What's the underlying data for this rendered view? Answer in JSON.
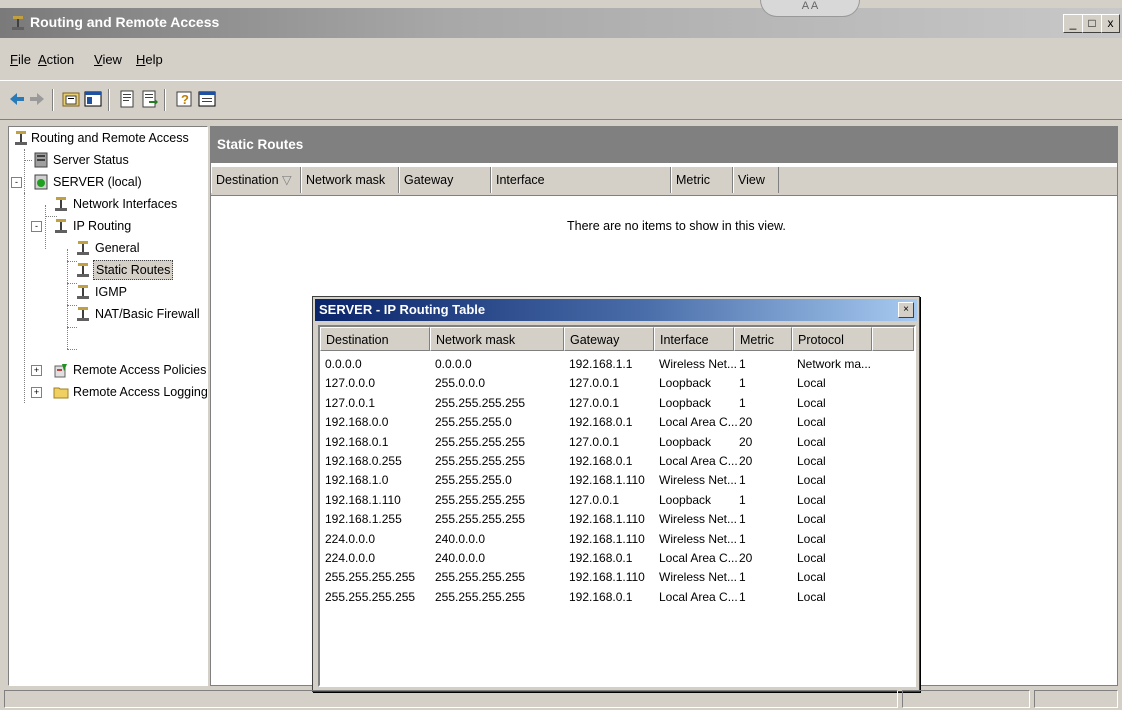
{
  "window": {
    "title": "Routing and Remote Access",
    "notch_text": "A A",
    "controls": {
      "minimize": "_",
      "maximize": "□",
      "close": "x"
    }
  },
  "menu": [
    "File",
    "Action",
    "View",
    "Help"
  ],
  "menu_underline": [
    "F",
    "A",
    "V",
    "H"
  ],
  "toolbar": {
    "icons": [
      "back-arrow-icon",
      "forward-arrow-icon",
      "up-folder-icon",
      "show-hide-tree-icon",
      "properties-icon",
      "export-list-icon",
      "help-icon",
      "console-icon"
    ]
  },
  "tree": {
    "items": [
      {
        "label": "Routing and Remote Access",
        "icon": "server-icon"
      },
      {
        "label": "Server Status",
        "icon": "server-status-icon"
      },
      {
        "label": "SERVER (local)",
        "icon": "server-local-icon"
      },
      {
        "label": "Network Interfaces",
        "icon": "routing-node-icon"
      },
      {
        "label": "IP Routing",
        "icon": "routing-node-icon"
      },
      {
        "label": "General",
        "icon": "routing-node-icon"
      },
      {
        "label": "Static Routes",
        "icon": "routing-node-icon"
      },
      {
        "label": "IGMP",
        "icon": "routing-node-icon"
      },
      {
        "label": "NAT/Basic Firewall",
        "icon": "routing-node-icon"
      },
      {
        "label": "Remote Access Policies",
        "icon": "policy-icon"
      },
      {
        "label": "Remote Access Logging",
        "icon": "folder-icon"
      }
    ]
  },
  "pane": {
    "title": "Static Routes",
    "columns": [
      "Destination",
      "Network mask",
      "Gateway",
      "Interface",
      "Metric",
      "View"
    ],
    "sort_indicator": "▽",
    "empty_message": "There are no items to show in this view."
  },
  "dialog": {
    "title": "SERVER - IP Routing Table",
    "close": "×",
    "columns": [
      "Destination",
      "Network mask",
      "Gateway",
      "Interface",
      "Metric",
      "Protocol"
    ],
    "rows": [
      [
        "0.0.0.0",
        "0.0.0.0",
        "192.168.1.1",
        "Wireless Net...",
        "1",
        "Network ma..."
      ],
      [
        "127.0.0.0",
        "255.0.0.0",
        "127.0.0.1",
        "Loopback",
        "1",
        "Local"
      ],
      [
        "127.0.0.1",
        "255.255.255.255",
        "127.0.0.1",
        "Loopback",
        "1",
        "Local"
      ],
      [
        "192.168.0.0",
        "255.255.255.0",
        "192.168.0.1",
        "Local Area C...",
        "20",
        "Local"
      ],
      [
        "192.168.0.1",
        "255.255.255.255",
        "127.0.0.1",
        "Loopback",
        "20",
        "Local"
      ],
      [
        "192.168.0.255",
        "255.255.255.255",
        "192.168.0.1",
        "Local Area C...",
        "20",
        "Local"
      ],
      [
        "192.168.1.0",
        "255.255.255.0",
        "192.168.1.110",
        "Wireless Net...",
        "1",
        "Local"
      ],
      [
        "192.168.1.110",
        "255.255.255.255",
        "127.0.0.1",
        "Loopback",
        "1",
        "Local"
      ],
      [
        "192.168.1.255",
        "255.255.255.255",
        "192.168.1.110",
        "Wireless Net...",
        "1",
        "Local"
      ],
      [
        "224.0.0.0",
        "240.0.0.0",
        "192.168.1.110",
        "Wireless Net...",
        "1",
        "Local"
      ],
      [
        "224.0.0.0",
        "240.0.0.0",
        "192.168.0.1",
        "Local Area C...",
        "20",
        "Local"
      ],
      [
        "255.255.255.255",
        "255.255.255.255",
        "192.168.1.110",
        "Wireless Net...",
        "1",
        "Local"
      ],
      [
        "255.255.255.255",
        "255.255.255.255",
        "192.168.0.1",
        "Local Area C...",
        "1",
        "Local"
      ]
    ]
  },
  "colors": {
    "window_face": "#d4d0c8",
    "pane_header": "#808080",
    "dialog_title_start": "#0a246a",
    "dialog_title_end": "#a6caf0"
  }
}
